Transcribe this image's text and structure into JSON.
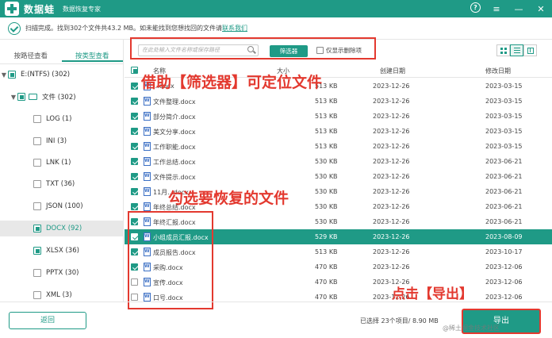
{
  "titlebar": {
    "app_name": "数据蛙",
    "app_subtitle": "数据恢复专家",
    "help_label": "?",
    "menu_label": "≡",
    "minimize_label": "—",
    "close_label": "✕"
  },
  "status": {
    "message": "扫描完成。找到302个文件共43.2 MB。如未能找到您想找回的文件请",
    "contact_link": "联系我们"
  },
  "left_tabs": [
    {
      "label": "按路径查看"
    },
    {
      "label": "按类型查看"
    }
  ],
  "tree": [
    {
      "label": "E:(NTFS) (302)"
    },
    {
      "label": "文件 (302)"
    },
    {
      "label": "LOG (1)"
    },
    {
      "label": "INI (3)"
    },
    {
      "label": "LNK (1)"
    },
    {
      "label": "TXT (36)"
    },
    {
      "label": "JSON (100)"
    },
    {
      "label": "DOCX (92)"
    },
    {
      "label": "XLSX (36)"
    },
    {
      "label": "PPTX (30)"
    },
    {
      "label": "XML (3)"
    }
  ],
  "search": {
    "placeholder": "在此处输入文件名称或保存路径",
    "filter_button": "筛选器",
    "show_deleted_label": "仅显示删除项"
  },
  "table": {
    "headers": {
      "name": "名称",
      "size": "大小",
      "created": "创建日期",
      "modified": "修改日期"
    },
    "rows": [
      {
        "name": "...docx",
        "size": "513 KB",
        "created": "2023-12-26",
        "modified": "2023-03-15"
      },
      {
        "name": "文件整理.docx",
        "size": "513 KB",
        "created": "2023-12-26",
        "modified": "2023-03-15"
      },
      {
        "name": "部分简介.docx",
        "size": "513 KB",
        "created": "2023-12-26",
        "modified": "2023-03-15"
      },
      {
        "name": "美文分享.docx",
        "size": "513 KB",
        "created": "2023-12-26",
        "modified": "2023-03-15"
      },
      {
        "name": "工作职能.docx",
        "size": "513 KB",
        "created": "2023-12-26",
        "modified": "2023-03-15"
      },
      {
        "name": "工作总结.docx",
        "size": "530 KB",
        "created": "2023-12-26",
        "modified": "2023-06-21"
      },
      {
        "name": "文件提示.docx",
        "size": "530 KB",
        "created": "2023-12-26",
        "modified": "2023-06-21"
      },
      {
        "name": "11月...docx",
        "size": "530 KB",
        "created": "2023-12-26",
        "modified": "2023-06-21"
      },
      {
        "name": "年终总结.docx",
        "size": "530 KB",
        "created": "2023-12-26",
        "modified": "2023-06-21"
      },
      {
        "name": "年终汇报.docx",
        "size": "530 KB",
        "created": "2023-12-26",
        "modified": "2023-06-21"
      },
      {
        "name": "小组成员汇报.docx",
        "size": "529 KB",
        "created": "2023-12-26",
        "modified": "2023-08-09"
      },
      {
        "name": "成员报告.docx",
        "size": "513 KB",
        "created": "2023-12-26",
        "modified": "2023-10-17"
      },
      {
        "name": "采购.docx",
        "size": "470 KB",
        "created": "2023-12-26",
        "modified": "2023-12-06"
      },
      {
        "name": "宣传.docx",
        "size": "470 KB",
        "created": "2023-12-26",
        "modified": "2023-12-06"
      },
      {
        "name": "口号.docx",
        "size": "470 KB",
        "created": "2023-12-26",
        "modified": "2023-12-06"
      }
    ]
  },
  "annotations": {
    "filter_hint": "借助【筛选器】可定位文件",
    "select_hint": "勾选要恢复的文件",
    "export_hint": "点击【导出】"
  },
  "bottom": {
    "back_button": "返回",
    "selected_info": "已选择 23个项目/ 8.90 MB",
    "export_button": "导出",
    "watermark": "@稀土掘金技术社区"
  },
  "colors": {
    "brand": "#1f9a86",
    "annotation": "#e3392f"
  }
}
